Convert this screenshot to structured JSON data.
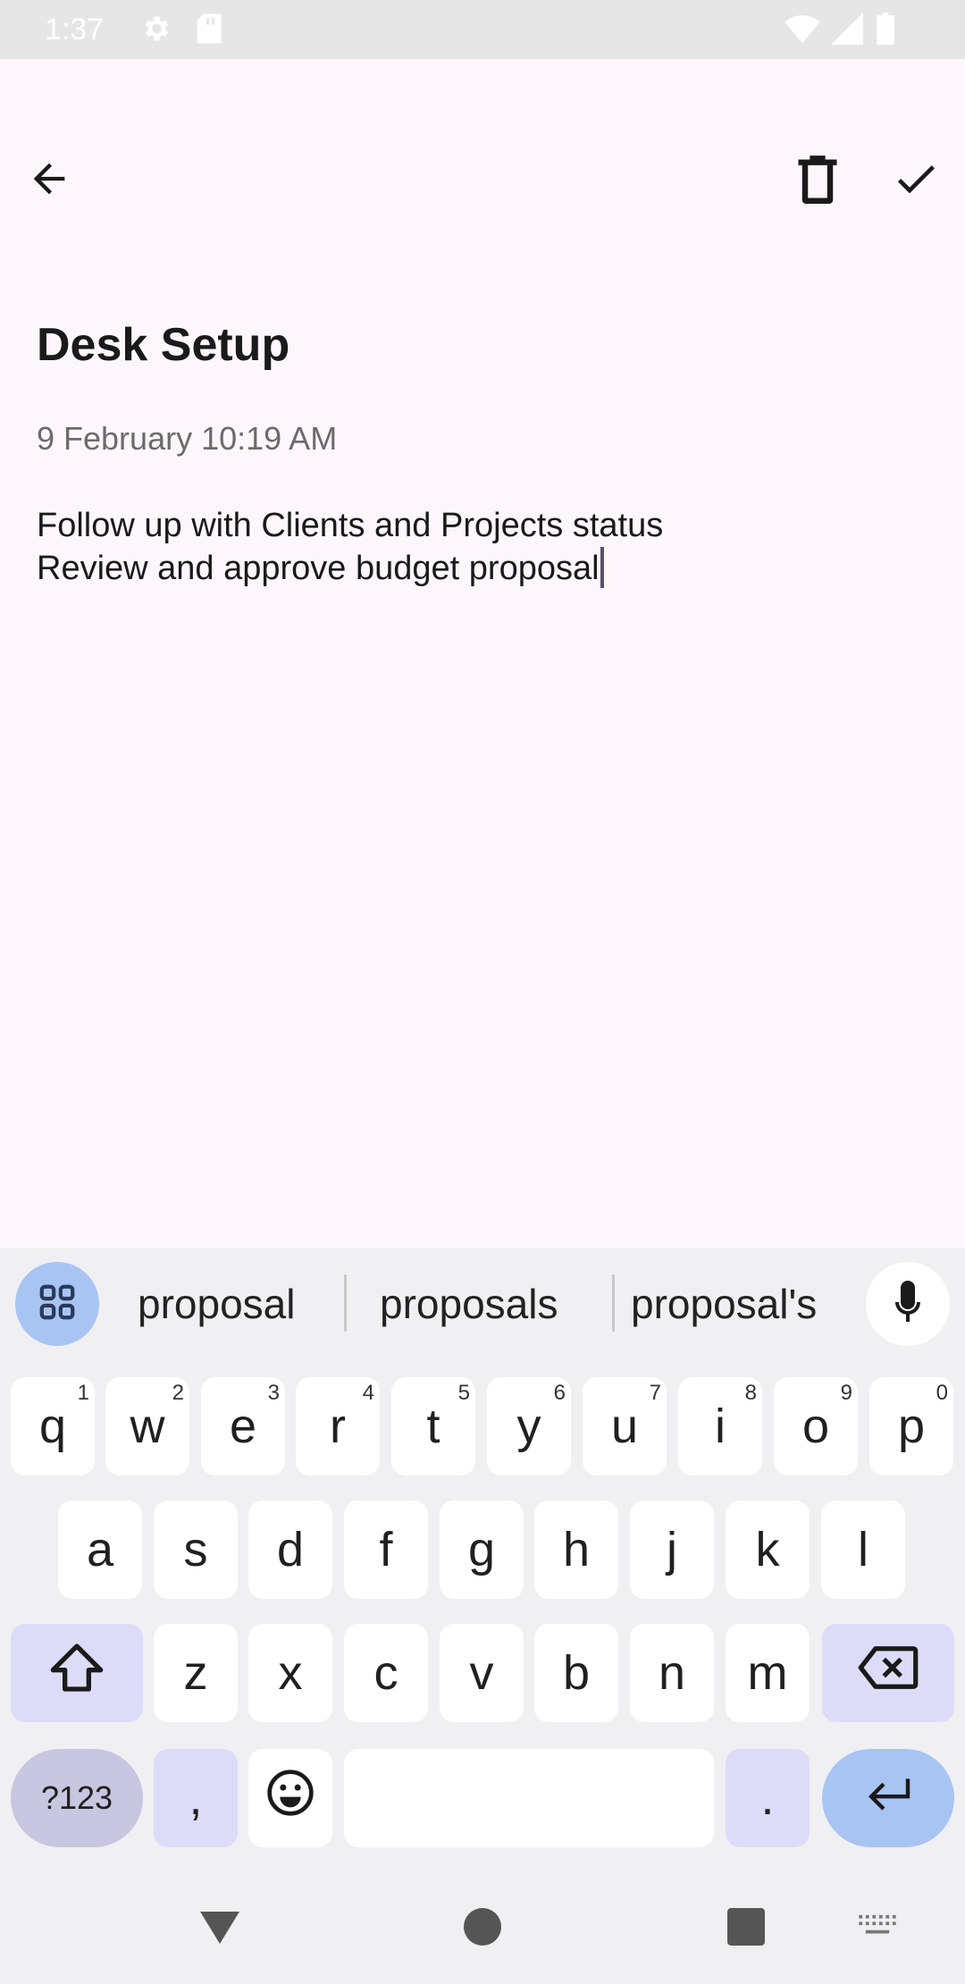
{
  "status_bar": {
    "time": "1:37",
    "icons": [
      "gear-icon",
      "sd-card-icon",
      "wifi-icon",
      "signal-icon",
      "battery-icon"
    ]
  },
  "toolbar": {
    "back_icon": "arrow-left-icon",
    "delete_icon": "trash-icon",
    "save_icon": "check-icon"
  },
  "note": {
    "title": "Desk Setup",
    "date": "9 February 10:19 AM",
    "body_lines": [
      "Follow up with Clients and Projects status",
      "Review and approve budget proposal"
    ]
  },
  "keyboard": {
    "suggestions": [
      "proposal",
      "proposals",
      "proposal's"
    ],
    "row1": [
      {
        "key": "q",
        "hint": "1"
      },
      {
        "key": "w",
        "hint": "2"
      },
      {
        "key": "e",
        "hint": "3"
      },
      {
        "key": "r",
        "hint": "4"
      },
      {
        "key": "t",
        "hint": "5"
      },
      {
        "key": "y",
        "hint": "6"
      },
      {
        "key": "u",
        "hint": "7"
      },
      {
        "key": "i",
        "hint": "8"
      },
      {
        "key": "o",
        "hint": "9"
      },
      {
        "key": "p",
        "hint": "0"
      }
    ],
    "row2": [
      "a",
      "s",
      "d",
      "f",
      "g",
      "h",
      "j",
      "k",
      "l"
    ],
    "row3": [
      "z",
      "x",
      "c",
      "v",
      "b",
      "n",
      "m"
    ],
    "symbols_label": "?123",
    "comma_label": ",",
    "period_label": "."
  },
  "colors": {
    "app_background": "#fdf7fc",
    "keyboard_background": "#f0f0f3",
    "accent_blue": "#a8c4f3",
    "modifier_key": "#dcdcf8"
  }
}
